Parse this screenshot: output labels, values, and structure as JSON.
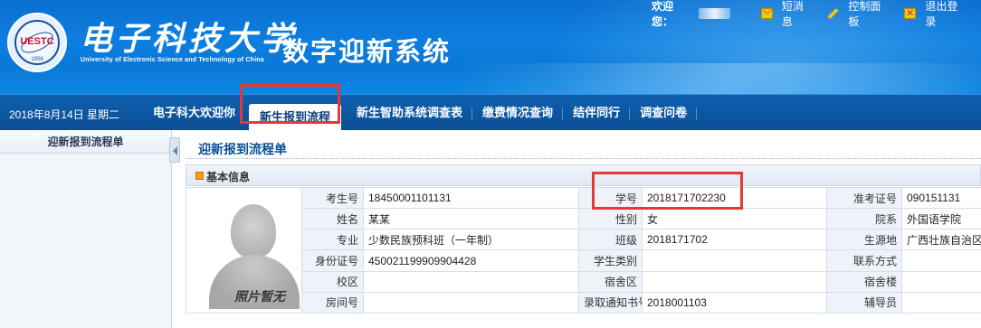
{
  "header": {
    "logo_text": "UESTC",
    "logo_year": "1956",
    "school_name_cn": "电子科技大学",
    "school_name_en": "University of Electronic Science and Technology of China",
    "system_title": "数字迎新系统",
    "welcome_label": "欢迎您：",
    "links": [
      {
        "label": "短消息",
        "icon": "mail-icon"
      },
      {
        "label": "控制面板",
        "icon": "pencil-icon"
      },
      {
        "label": "退出登录",
        "icon": "exit-icon"
      }
    ]
  },
  "nav": {
    "date": "2018年8月14日 星期二",
    "items": [
      {
        "label": "电子科大欢迎你"
      },
      {
        "label": "新生报到流程"
      },
      {
        "label": "新生智助系统调查表"
      },
      {
        "label": "缴费情况查询"
      },
      {
        "label": "结伴同行"
      },
      {
        "label": "调查问卷"
      }
    ]
  },
  "sidebar": {
    "items": [
      {
        "label": "迎新报到流程单"
      }
    ]
  },
  "main": {
    "page_title": "迎新报到流程单",
    "section_title": "基本信息",
    "photo_caption": "照片暂无",
    "rows": [
      [
        {
          "label": "考生号",
          "value": "18450001101131"
        },
        {
          "label": "学号",
          "value": "2018171702230"
        },
        {
          "label": "准考证号",
          "value": "090151131"
        }
      ],
      [
        {
          "label": "姓名",
          "value": "某某"
        },
        {
          "label": "性别",
          "value": "女"
        },
        {
          "label": "院系",
          "value": "外国语学院"
        }
      ],
      [
        {
          "label": "专业",
          "value": "少数民族预科班（一年制）"
        },
        {
          "label": "班级",
          "value": "2018171702"
        },
        {
          "label": "生源地",
          "value": "广西壮族自治区"
        }
      ],
      [
        {
          "label": "身份证号",
          "value": "450021199909904428"
        },
        {
          "label": "学生类别",
          "value": ""
        },
        {
          "label": "联系方式",
          "value": ""
        }
      ],
      [
        {
          "label": "校区",
          "value": ""
        },
        {
          "label": "宿舍区",
          "value": ""
        },
        {
          "label": "宿舍楼",
          "value": ""
        }
      ],
      [
        {
          "label": "房间号",
          "value": ""
        },
        {
          "label": "录取通知书号",
          "value": "2018001103"
        },
        {
          "label": "辅导员",
          "value": ""
        }
      ]
    ]
  },
  "colors": {
    "header_blue": "#0a78d6",
    "nav_blue": "#0b4f96",
    "highlight_red": "#e53935"
  }
}
